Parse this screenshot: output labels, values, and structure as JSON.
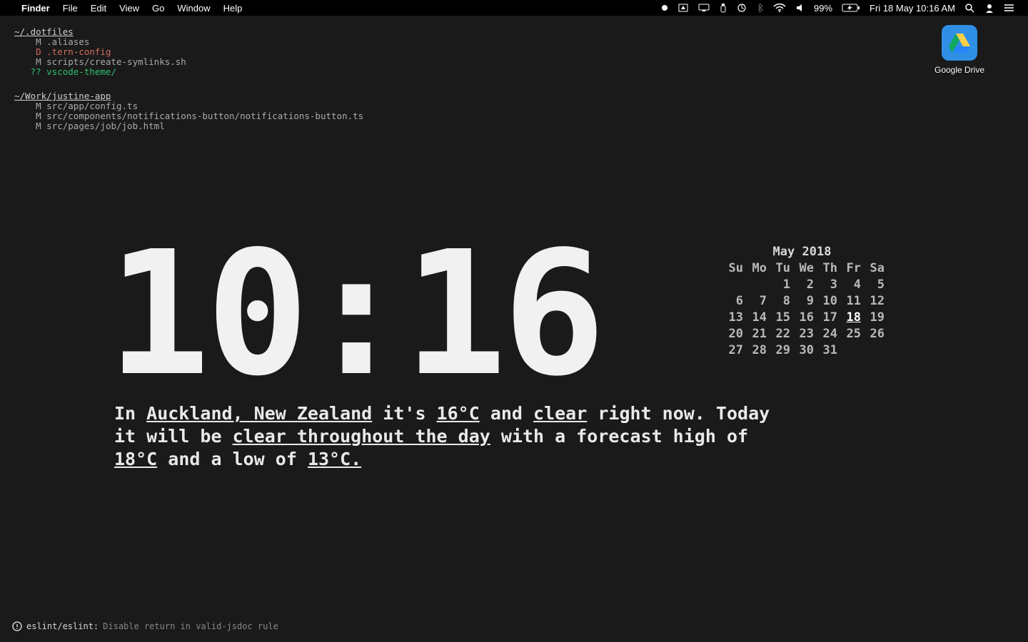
{
  "menubar": {
    "app": "Finder",
    "menus": [
      "File",
      "Edit",
      "View",
      "Go",
      "Window",
      "Help"
    ],
    "battery": "99%",
    "datetime": "Fri 18 May  10:16 AM"
  },
  "desktop_icon": {
    "label": "Google Drive"
  },
  "git": {
    "repos": [
      {
        "path": "~/.dotfiles",
        "items": [
          {
            "s": "M",
            "f": ".aliases",
            "cls": "M"
          },
          {
            "s": "D",
            "f": ".tern-config",
            "cls": "D"
          },
          {
            "s": "M",
            "f": "scripts/create-symlinks.sh",
            "cls": "M"
          },
          {
            "s": "??",
            "f": "vscode-theme/",
            "cls": "Q"
          }
        ]
      },
      {
        "path": "~/Work/justine-app",
        "items": [
          {
            "s": "M",
            "f": "src/app/config.ts",
            "cls": "M"
          },
          {
            "s": "M",
            "f": "src/components/notifications-button/notifications-button.ts",
            "cls": "M"
          },
          {
            "s": "M",
            "f": "src/pages/job/job.html",
            "cls": "M"
          }
        ]
      }
    ]
  },
  "clock": "10:16",
  "weather": {
    "location": "Auckland, New Zealand",
    "temp": "16°C",
    "cond": "clear",
    "forecast": "clear throughout the day",
    "high": "18°C",
    "low": "13°C."
  },
  "calendar": {
    "title": "May 2018",
    "dow": [
      "Su",
      "Mo",
      "Tu",
      "We",
      "Th",
      "Fr",
      "Sa"
    ],
    "weeks": [
      [
        "",
        "",
        "1",
        "2",
        "3",
        "4",
        "5"
      ],
      [
        "6",
        "7",
        "8",
        "9",
        "10",
        "11",
        "12"
      ],
      [
        "13",
        "14",
        "15",
        "16",
        "17",
        "18",
        "19"
      ],
      [
        "20",
        "21",
        "22",
        "23",
        "24",
        "25",
        "26"
      ],
      [
        "27",
        "28",
        "29",
        "30",
        "31",
        "",
        ""
      ]
    ],
    "today": "18"
  },
  "gh_issue": {
    "repo": "eslint/eslint:",
    "title": "Disable return in valid-jsdoc rule"
  }
}
